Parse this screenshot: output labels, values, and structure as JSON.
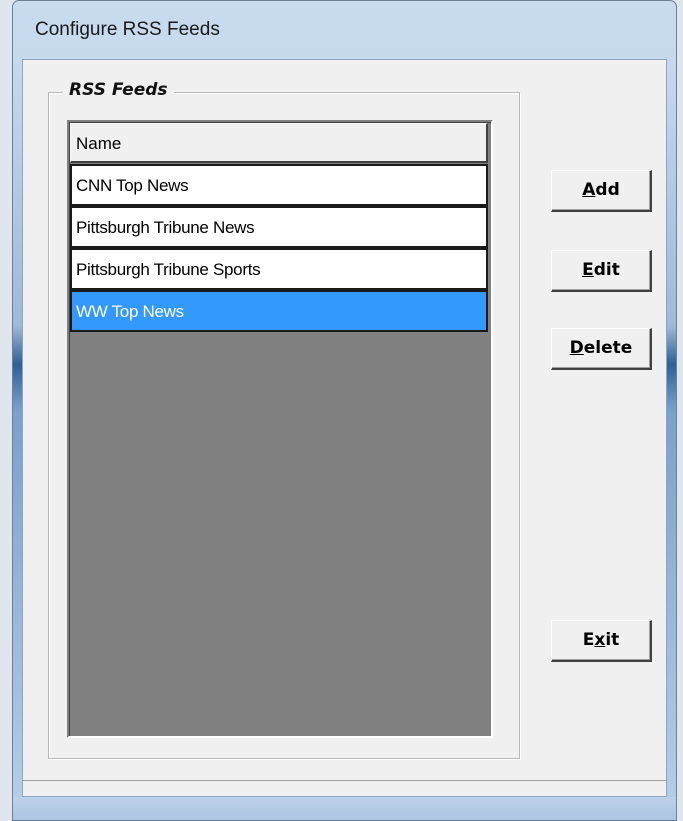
{
  "window": {
    "title": "Configure RSS Feeds"
  },
  "group": {
    "label": "RSS Feeds"
  },
  "list": {
    "column_header": "Name",
    "items": [
      {
        "label": "CNN Top News",
        "selected": false
      },
      {
        "label": "Pittsburgh Tribune News",
        "selected": false
      },
      {
        "label": "Pittsburgh Tribune Sports",
        "selected": false
      },
      {
        "label": "WW Top News",
        "selected": true
      }
    ]
  },
  "buttons": {
    "add": {
      "pre": "",
      "accel": "A",
      "post": "dd"
    },
    "edit": {
      "pre": "",
      "accel": "E",
      "post": "dit"
    },
    "delete": {
      "pre": "",
      "accel": "D",
      "post": "elete"
    },
    "exit": {
      "pre": "E",
      "accel": "x",
      "post": "it"
    }
  },
  "colors": {
    "selection": "#3399ff",
    "list_background": "#808080",
    "dialog_background": "#f0f0f0"
  }
}
